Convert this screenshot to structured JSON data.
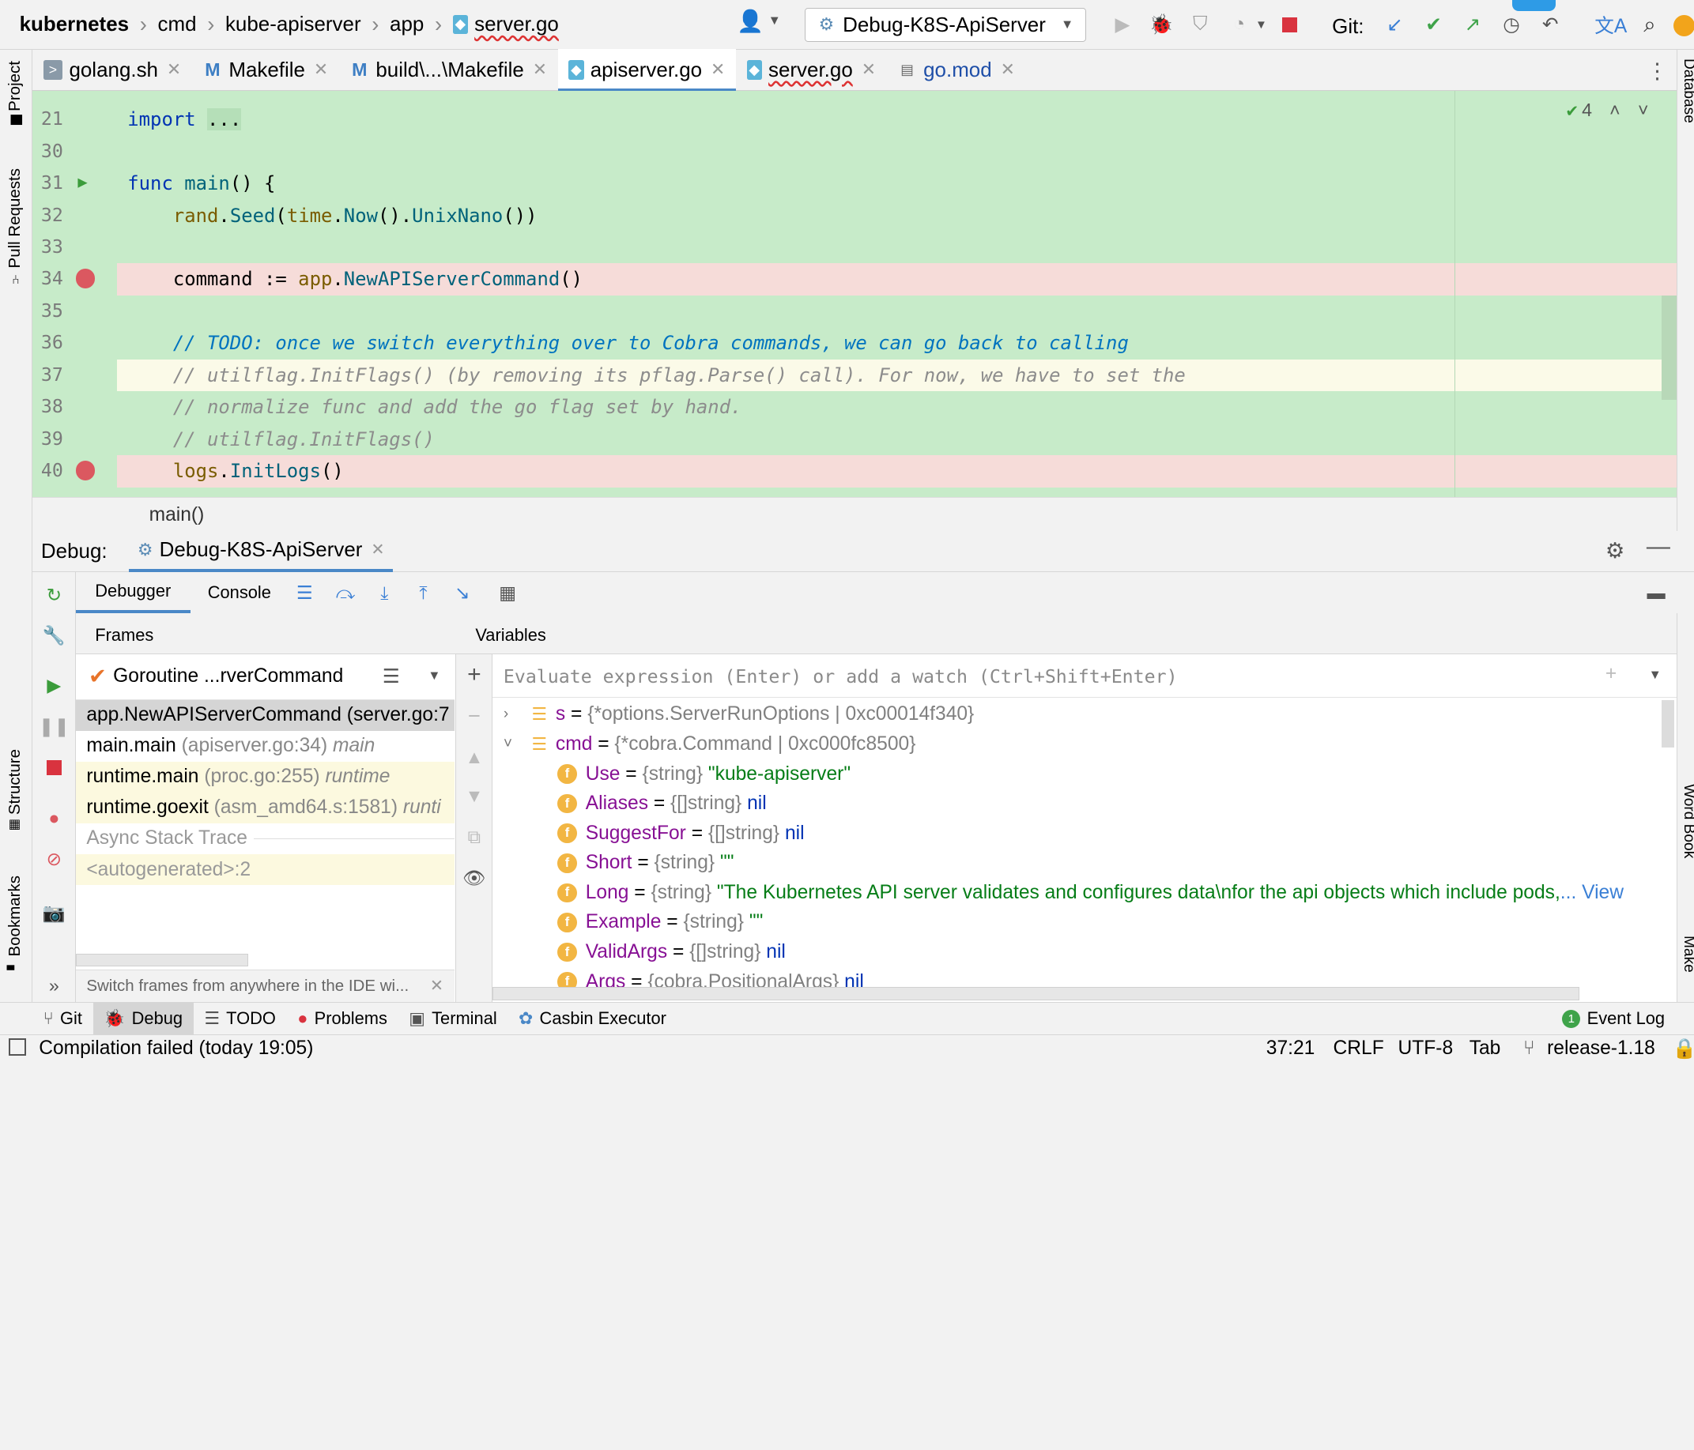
{
  "navbar": {
    "breadcrumbs": [
      "kubernetes",
      "cmd",
      "kube-apiserver",
      "app",
      "server.go"
    ],
    "run_config": "Debug-K8S-ApiServer",
    "git_label": "Git:"
  },
  "tabs": [
    {
      "label": "golang.sh",
      "icon": "shell-file-icon"
    },
    {
      "label": "Makefile",
      "icon": "makefile-icon"
    },
    {
      "label": "build\\...\\Makefile",
      "icon": "makefile-icon"
    },
    {
      "label": "apiserver.go",
      "icon": "go-file-icon",
      "active": true
    },
    {
      "label": "server.go",
      "icon": "go-file-icon"
    },
    {
      "label": "go.mod",
      "icon": "gomod-file-icon"
    }
  ],
  "left_strip": {
    "project": "Project",
    "pull_requests": "Pull Requests",
    "structure": "Structure",
    "bookmarks": "Bookmarks"
  },
  "right_strip": {
    "database": "Database",
    "word_book": "Word Book",
    "make": "Make"
  },
  "editor": {
    "inspection_count": "4",
    "lines": [
      {
        "num": "21",
        "text": "import ..."
      },
      {
        "num": "30",
        "text": ""
      },
      {
        "num": "31",
        "text": "func main() {"
      },
      {
        "num": "32",
        "text": "rand.Seed(time.Now().UnixNano())"
      },
      {
        "num": "33",
        "text": ""
      },
      {
        "num": "34",
        "text": "command := app.NewAPIServerCommand()"
      },
      {
        "num": "35",
        "text": ""
      },
      {
        "num": "36",
        "text": "// TODO: once we switch everything over to Cobra commands, we can go back to calling"
      },
      {
        "num": "37",
        "text": "// utilflag.InitFlags() (by removing its pflag.Parse() call). For now, we have to set the"
      },
      {
        "num": "38",
        "text": "// normalize func and add the go flag set by hand."
      },
      {
        "num": "39",
        "text": "// utilflag.InitFlags()"
      },
      {
        "num": "40",
        "text": "logs.InitLogs()"
      }
    ],
    "breadcrumb": "main()"
  },
  "debug": {
    "label": "Debug:",
    "session": "Debug-K8S-ApiServer",
    "tabs": [
      "Debugger",
      "Console"
    ],
    "frames_header": "Frames",
    "variables_header": "Variables",
    "goroutine": "Goroutine ...rverCommand",
    "frames": [
      {
        "fn": "app.NewAPIServerCommand",
        "loc": "(server.go:7",
        "extra": "",
        "selected": true
      },
      {
        "fn": "main.main",
        "loc": "(apiserver.go:34)",
        "extra": "main"
      },
      {
        "fn": "runtime.main",
        "loc": "(proc.go:255)",
        "extra": "runtime"
      },
      {
        "fn": "runtime.goexit",
        "loc": "(asm_amd64.s:1581)",
        "extra": "runti"
      }
    ],
    "async_label": "Async Stack Trace",
    "autogen": "<autogenerated>:2",
    "hint": "Switch frames from anywhere in the IDE wi...",
    "eval_placeholder": "Evaluate expression (Enter) or add a watch (Ctrl+Shift+Enter)",
    "variables": [
      {
        "name": "s",
        "type": "{*options.ServerRunOptions | 0xc00014f340}",
        "value": "",
        "kind": "struct",
        "expanded": false
      },
      {
        "name": "cmd",
        "type": "{*cobra.Command | 0xc000fc8500}",
        "value": "",
        "kind": "struct",
        "expanded": true
      },
      {
        "name": "Use",
        "type": "{string}",
        "value": "\"kube-apiserver\"",
        "kind": "field"
      },
      {
        "name": "Aliases",
        "type": "{[]string}",
        "value": "nil",
        "kind": "field"
      },
      {
        "name": "SuggestFor",
        "type": "{[]string}",
        "value": "nil",
        "kind": "field"
      },
      {
        "name": "Short",
        "type": "{string}",
        "value": "\"\"",
        "kind": "field"
      },
      {
        "name": "Long",
        "type": "{string}",
        "value": "\"The Kubernetes API server validates and configures data\\nfor the api objects which include pods,",
        "kind": "field",
        "more": "... View"
      },
      {
        "name": "Example",
        "type": "{string}",
        "value": "\"\"",
        "kind": "field"
      },
      {
        "name": "ValidArgs",
        "type": "{[]string}",
        "value": "nil",
        "kind": "field"
      },
      {
        "name": "Args",
        "type": "{cobra.PositionalArgs}",
        "value": "nil",
        "kind": "field"
      }
    ]
  },
  "toolwindows": [
    {
      "label": "Git",
      "icon": "git-branch-icon"
    },
    {
      "label": "Debug",
      "icon": "bug-icon",
      "active": true
    },
    {
      "label": "TODO",
      "icon": "list-icon"
    },
    {
      "label": "Problems",
      "icon": "error-icon"
    },
    {
      "label": "Terminal",
      "icon": "terminal-icon"
    },
    {
      "label": "Casbin Executor",
      "icon": "casbin-icon"
    }
  ],
  "event_log": {
    "label": "Event Log",
    "count": "1"
  },
  "status": {
    "message": "Compilation failed (today 19:05)",
    "position": "37:21",
    "line_sep": "CRLF",
    "encoding": "UTF-8",
    "indent": "Tab",
    "branch": "release-1.18"
  }
}
